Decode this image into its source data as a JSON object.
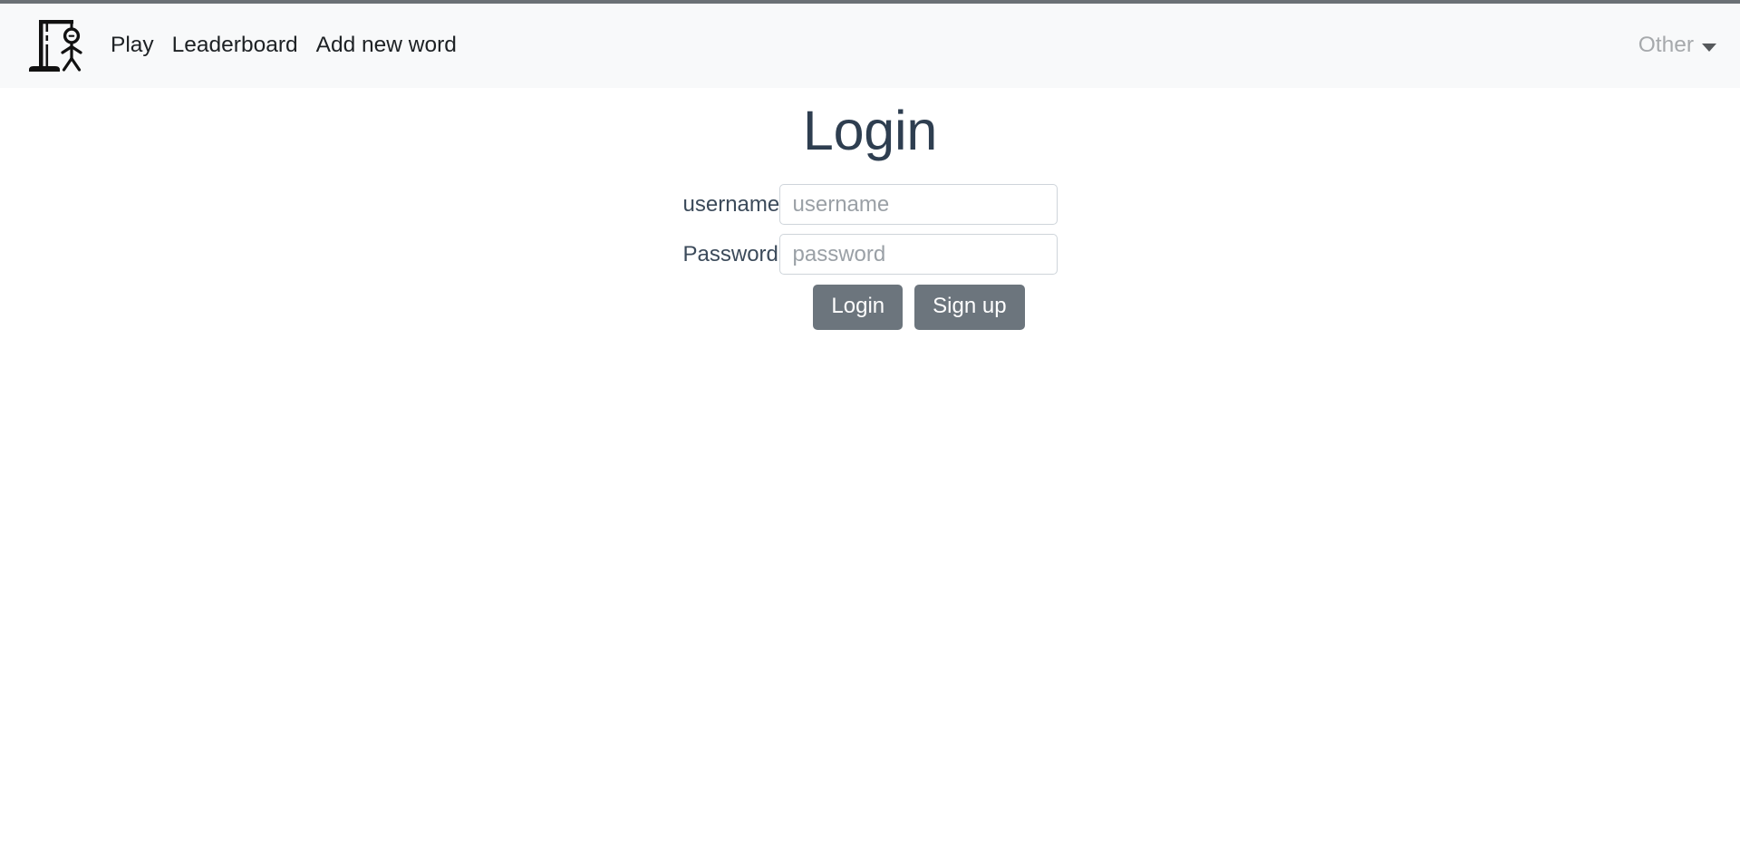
{
  "window": {
    "top_edge_color": "#6b7075"
  },
  "navbar": {
    "background_color": "#f8f9fa",
    "brand": {
      "icon": "hangman-gallows-icon",
      "alt": "Hangman"
    },
    "links": [
      {
        "label": "Play",
        "name": "nav-link-play"
      },
      {
        "label": "Leaderboard",
        "name": "nav-link-leaderboard"
      },
      {
        "label": "Add new word",
        "name": "nav-link-add-new-word"
      }
    ],
    "dropdown": {
      "label": "Other",
      "icon": "chevron-down-icon",
      "color": "#a6a9ac"
    }
  },
  "main": {
    "title": "Login",
    "title_color": "#2e3e50",
    "form": {
      "fields": [
        {
          "label": "username",
          "placeholder": "username",
          "value": "",
          "type": "text",
          "name": "username-field"
        },
        {
          "label": "Password",
          "placeholder": "password",
          "value": "",
          "type": "password",
          "name": "password-field"
        }
      ],
      "buttons": [
        {
          "label": "Login",
          "name": "login-button",
          "color": "#6c757d"
        },
        {
          "label": "Sign up",
          "name": "signup-button",
          "color": "#6c757d"
        }
      ]
    }
  }
}
